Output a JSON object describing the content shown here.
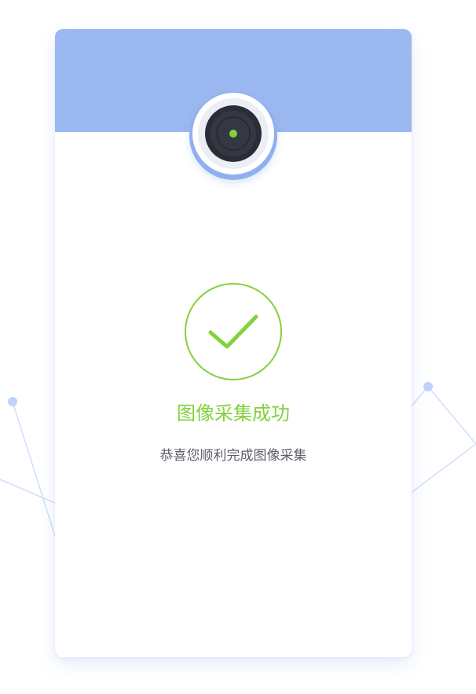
{
  "theme": {
    "header_color": "#9BB8F0",
    "success_color": "#83D13B",
    "title_color": "#83D13B",
    "subtitle_color": "#5B5F68",
    "line_color": "#C9DAFA",
    "dot_color": "#BCD3FB"
  },
  "result": {
    "title": "图像采集成功",
    "subtitle": "恭喜您顺利完成图像采集"
  },
  "icons": {
    "camera": "camera-icon",
    "success": "check-circle-icon"
  }
}
